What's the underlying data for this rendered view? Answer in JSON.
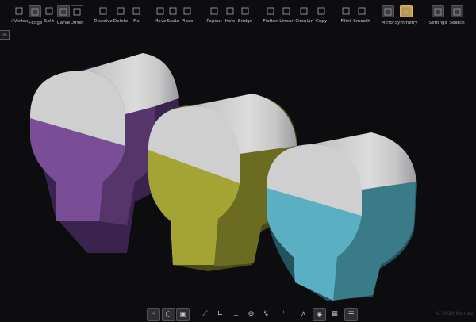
{
  "toolbar": {
    "tools": [
      {
        "label": "+Vertex",
        "icon": "add-vertex-icon"
      },
      {
        "label": "+Edge",
        "icon": "add-edge-icon"
      },
      {
        "label": "Split",
        "icon": "split-icon"
      },
      {
        "label": "Carve",
        "icon": "carve-icon"
      },
      {
        "label": "Offset",
        "icon": "offset-icon"
      },
      {
        "label": "Dissolve",
        "icon": "dissolve-icon"
      },
      {
        "label": "Delete",
        "icon": "delete-icon"
      },
      {
        "label": "Fix",
        "icon": "fix-icon"
      },
      {
        "label": "Move",
        "icon": "move-icon"
      },
      {
        "label": "Scale",
        "icon": "scale-icon"
      },
      {
        "label": "Place",
        "icon": "place-icon"
      },
      {
        "label": "Popout",
        "icon": "popout-icon"
      },
      {
        "label": "Hole",
        "icon": "hole-icon"
      },
      {
        "label": "Bridge",
        "icon": "bridge-icon"
      },
      {
        "label": "Flatten",
        "icon": "flatten-icon"
      },
      {
        "label": "Linear",
        "icon": "linear-icon"
      },
      {
        "label": "Circular",
        "icon": "circular-icon"
      },
      {
        "label": "Copy",
        "icon": "copy-icon"
      },
      {
        "label": "Fillet",
        "icon": "fillet-icon"
      },
      {
        "label": "Smooth",
        "icon": "smooth-icon"
      },
      {
        "label": "Mirror",
        "icon": "mirror-icon"
      },
      {
        "label": "Symmetry",
        "icon": "symmetry-icon"
      },
      {
        "label": "Settings",
        "icon": "settings-icon"
      },
      {
        "label": "Search",
        "icon": "search-icon"
      }
    ]
  },
  "side_tab": {
    "label": "TA"
  },
  "scene": {
    "objects": [
      {
        "name": "purple bulb",
        "color": "#7a4d97"
      },
      {
        "name": "olive bulb",
        "color": "#a4a434"
      },
      {
        "name": "cyan bulb",
        "color": "#5ab0c2"
      }
    ],
    "cap_color": "#cfcfcf"
  },
  "bottom_bar": {
    "buttons": [
      {
        "icon": "select-hand-icon",
        "glyph": "☝"
      },
      {
        "icon": "wire-cube-icon",
        "glyph": "⬡"
      },
      {
        "icon": "solid-cube-icon",
        "glyph": "▣"
      },
      {
        "icon": "snap-edge-icon",
        "glyph": "⟋"
      },
      {
        "icon": "snap-angle-icon",
        "glyph": "∟"
      },
      {
        "icon": "snap-point-icon",
        "glyph": "⟂"
      },
      {
        "icon": "zoom-icon",
        "glyph": "⊕"
      },
      {
        "icon": "lasso-icon",
        "glyph": "↯"
      },
      {
        "icon": "add-point-icon",
        "glyph": "⁺"
      },
      {
        "icon": "axes-icon",
        "glyph": "⋏"
      },
      {
        "icon": "render-cube-icon",
        "glyph": "◈"
      },
      {
        "icon": "grid-icon",
        "glyph": "▦"
      },
      {
        "icon": "sliders-icon",
        "glyph": "☰"
      }
    ]
  },
  "copyright": "© 2020 Nomad"
}
